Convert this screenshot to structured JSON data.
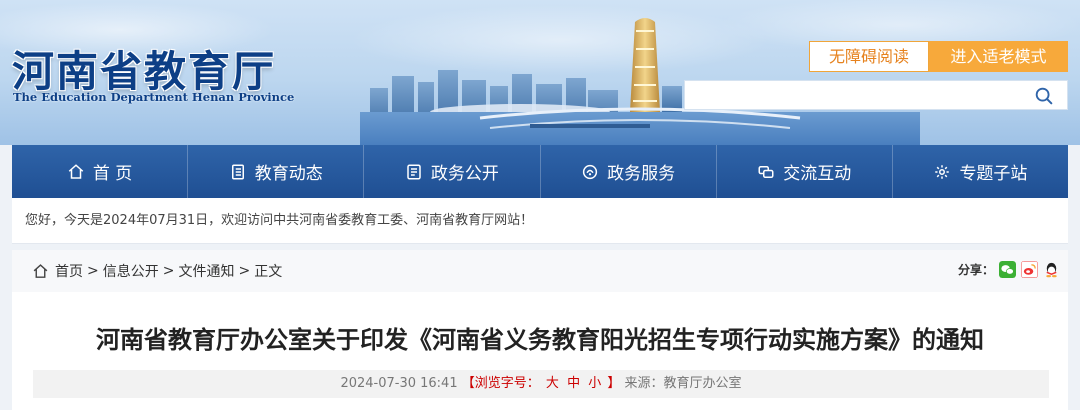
{
  "header": {
    "site_name_cn": "河南省教育厅",
    "site_name_en": "The Education Department Henan Province",
    "accessibility_label": "无障碍阅读",
    "elder_mode_label": "进入适老模式",
    "search_placeholder": ""
  },
  "nav": {
    "items": [
      {
        "label": "首 页",
        "icon": "home-icon"
      },
      {
        "label": "教育动态",
        "icon": "news-icon"
      },
      {
        "label": "政务公开",
        "icon": "document-icon"
      },
      {
        "label": "政务服务",
        "icon": "service-icon"
      },
      {
        "label": "交流互动",
        "icon": "chat-icon"
      },
      {
        "label": "专题子站",
        "icon": "topic-icon"
      }
    ]
  },
  "welcome_text": "您好，今天是2024年07月31日，欢迎访问中共河南省委教育工委、河南省教育厅网站！",
  "breadcrumb": {
    "items": [
      "首页",
      "信息公开",
      "文件通知",
      "正文"
    ],
    "separator": ">"
  },
  "share": {
    "label": "分享：",
    "targets": [
      "wechat-icon",
      "weibo-icon",
      "qq-icon"
    ]
  },
  "article": {
    "title": "河南省教育厅办公室关于印发《河南省义务教育阳光招生专项行动实施方案》的通知",
    "date": "2024-07-30 16:41",
    "font_size_prefix": "【浏览字号：",
    "font_sizes": [
      "大",
      "中",
      "小"
    ],
    "font_size_suffix": "】",
    "source": "来源：教育厅办公室"
  },
  "colors": {
    "nav_bg": "#2a5ba0",
    "brand_blue": "#0d3f86",
    "accent_orange": "#f7a93b",
    "accent_red": "#cc0000"
  }
}
